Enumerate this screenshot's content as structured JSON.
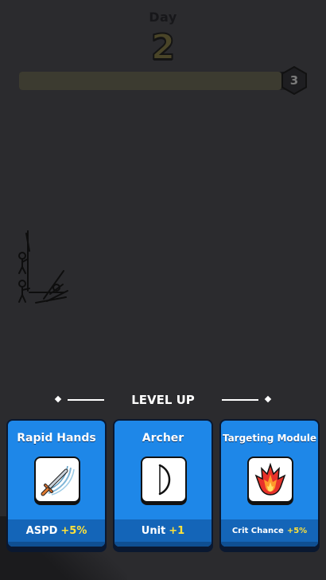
{
  "hud": {
    "day_label": "Day",
    "day_number": "2",
    "next_goal": "3",
    "progress": 0.96
  },
  "level_up": {
    "title": "LEVEL UP",
    "cards": [
      {
        "title": "Rapid Hands",
        "icon": "sword-slash-icon",
        "stat": "ASPD",
        "bonus": "+5%"
      },
      {
        "title": "Archer",
        "icon": "bow-icon",
        "stat": "Unit",
        "bonus": "+1"
      },
      {
        "title": "Targeting Module",
        "icon": "fire-icon",
        "stat": "Crit Chance",
        "bonus": "+5%"
      }
    ]
  },
  "colors": {
    "card_blue": "#1e87e8",
    "card_footer": "#1465b8",
    "bonus_yellow": "#ffe23a",
    "day_number_olive": "#4a4528"
  }
}
